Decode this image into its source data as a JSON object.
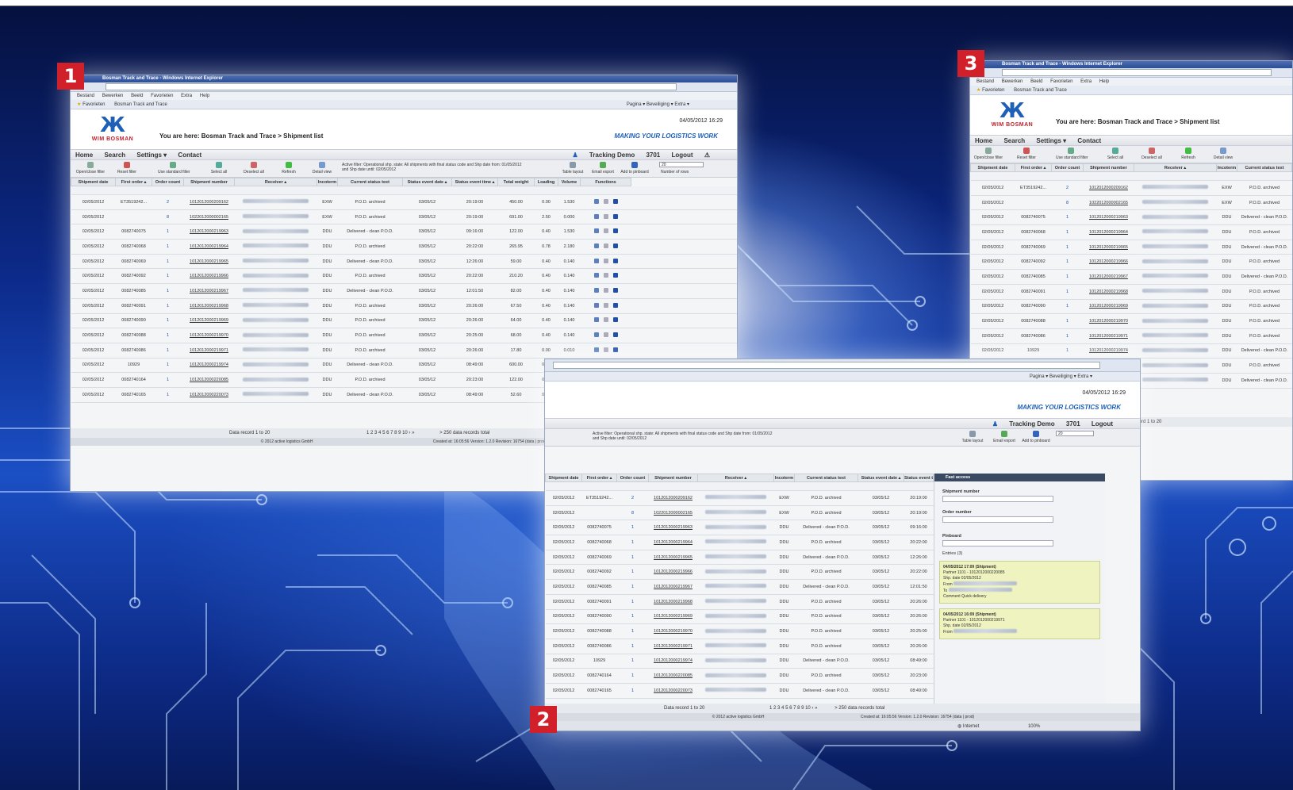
{
  "badges": [
    "1",
    "2",
    "3"
  ],
  "ie": {
    "title": "Bosman Track and Trace - Windows Internet Explorer",
    "menu": [
      "Bestand",
      "Bewerken",
      "Beeld",
      "Favorieten",
      "Extra",
      "Help"
    ],
    "fav_label": "Favorieten",
    "tab_label": "Bosman Track and Trace",
    "cmd_items": "Pagina ▾   Beveiliging ▾   Extra ▾",
    "status_zone": "Internet",
    "zoom": "100%"
  },
  "app": {
    "logo_text": "WIM BOSMAN",
    "breadcrumb": "You are here: Bosman Track and Trace > Shipment list",
    "tagline": "MAKING YOUR LOGISTICS WORK",
    "datestamp": "04/05/2012  16:29",
    "nav": [
      "Home",
      "Search",
      "Settings ▾",
      "Contact"
    ],
    "user": "Tracking Demo",
    "user_id": "3701",
    "logout": "Logout",
    "toolbar": [
      "Open/close filter",
      "Reset filter",
      "Use standard filter",
      "Select all",
      "Deselect all",
      "Refresh",
      "Detail view"
    ],
    "toolbar_right": [
      "Table layout",
      "Email export",
      "Add to pinboard"
    ],
    "rows_label": "Number of rows",
    "rows_value": "20",
    "filter_note": "Active filter: Operational shp. state: All shipments with final status code and Shp date from: 01/05/2012 and Shp date until: 02/05/2012",
    "columns": [
      "Shipment date",
      "First order ▴",
      "Order count",
      "Shipment number",
      "Receiver ▴",
      "Incoterm",
      "Current status text",
      "Status event date ▴",
      "Status event time ▴",
      "Total weight",
      "Loading",
      "Volume",
      "Functions"
    ],
    "rows": [
      [
        "02/05/2012",
        "ET3519242...",
        "2",
        "1012012000209162",
        "EXW",
        "P.O.D. archived",
        "03/05/12",
        "20:19:00",
        "450.00",
        "0.00",
        "1.530"
      ],
      [
        "02/05/2012",
        "",
        "8",
        "1022012000002165",
        "EXW",
        "P.O.D. archived",
        "03/05/12",
        "20:19:00",
        "691.00",
        "2.50",
        "0.000"
      ],
      [
        "02/05/2012",
        "0082740075",
        "1",
        "1012012000219963",
        "DDU",
        "Delivered - clean P.O.D.",
        "03/05/12",
        "09:16:00",
        "122.00",
        "0.40",
        "1.530"
      ],
      [
        "02/05/2012",
        "0082740068",
        "1",
        "1012012000219964",
        "DDU",
        "P.O.D. archived",
        "03/05/12",
        "20:22:00",
        "265.95",
        "0.78",
        "2.180"
      ],
      [
        "02/05/2012",
        "0082740069",
        "1",
        "1012012000219965",
        "DDU",
        "Delivered - clean P.O.D.",
        "03/05/12",
        "12:26:00",
        "59.00",
        "0.40",
        "0.140"
      ],
      [
        "02/05/2012",
        "0082740092",
        "1",
        "1012012000219966",
        "DDU",
        "P.O.D. archived",
        "03/05/12",
        "20:22:00",
        "210.20",
        "0.40",
        "0.140"
      ],
      [
        "02/05/2012",
        "0082740085",
        "1",
        "1012012000219967",
        "DDU",
        "Delivered - clean P.O.D.",
        "03/05/12",
        "12:01:50",
        "82.00",
        "0.40",
        "0.140"
      ],
      [
        "02/05/2012",
        "0082740091",
        "1",
        "1012012000219968",
        "DDU",
        "P.O.D. archived",
        "03/05/12",
        "20:26:00",
        "67.50",
        "0.40",
        "0.140"
      ],
      [
        "02/05/2012",
        "0082740090",
        "1",
        "1012012000219969",
        "DDU",
        "P.O.D. archived",
        "03/05/12",
        "20:26:00",
        "64.00",
        "0.40",
        "0.140"
      ],
      [
        "02/05/2012",
        "0082740088",
        "1",
        "1012012000219970",
        "DDU",
        "P.O.D. archived",
        "03/05/12",
        "20:25:00",
        "68.00",
        "0.40",
        "0.140"
      ],
      [
        "02/05/2012",
        "0082740086",
        "1",
        "1012012000219971",
        "DDU",
        "P.O.D. archived",
        "03/05/12",
        "20:26:00",
        "17.80",
        "0.00",
        "0.010"
      ],
      [
        "02/05/2012",
        "10929",
        "1",
        "1012012000219974",
        "DDU",
        "Delivered - clean P.O.D.",
        "03/05/12",
        "08:49:00",
        "600.00",
        "0.40",
        "0.000"
      ],
      [
        "02/05/2012",
        "0082740164",
        "1",
        "1012012000220085",
        "DDU",
        "P.O.D. archived",
        "03/05/12",
        "20:23:00",
        "122.00",
        "0.40",
        "1.440"
      ],
      [
        "02/05/2012",
        "0082740165",
        "1",
        "1012012000220073",
        "DDU",
        "Delivered - clean P.O.D.",
        "03/05/12",
        "08:49:00",
        "52.60",
        "0.90",
        "1.190"
      ]
    ],
    "pager_text": "Data record 1 to 20",
    "pager_total": "> 250 data records total",
    "footer_left": "© 2012 active logistics GmbH",
    "footer_right": "Created at: 16:05:56  Version: 1.2.0  Revision: 16754 (data | prod)",
    "fast_access": {
      "title": "Fast access",
      "shipment_label": "Shipment number",
      "order_label": "Order number",
      "pinboard": "Pinboard",
      "entries": "Entries (3)",
      "cards": [
        {
          "head": "04/05/2012 17:09 (Shipment)",
          "partner_label": "Partner",
          "partner": "1101 - 1012012000220085",
          "date_label": "Shp. date",
          "date": "02/05/2012",
          "from_label": "From",
          "to_label": "To",
          "comment_label": "Comment",
          "comment": "Quick delivery"
        },
        {
          "head": "04/05/2012 16:09 (Shipment)",
          "partner_label": "Partner",
          "partner": "1101 - 1012012000219971",
          "date_label": "Shp. date",
          "date": "02/05/2012",
          "from_label": "From",
          "to_label": "To"
        }
      ]
    }
  }
}
